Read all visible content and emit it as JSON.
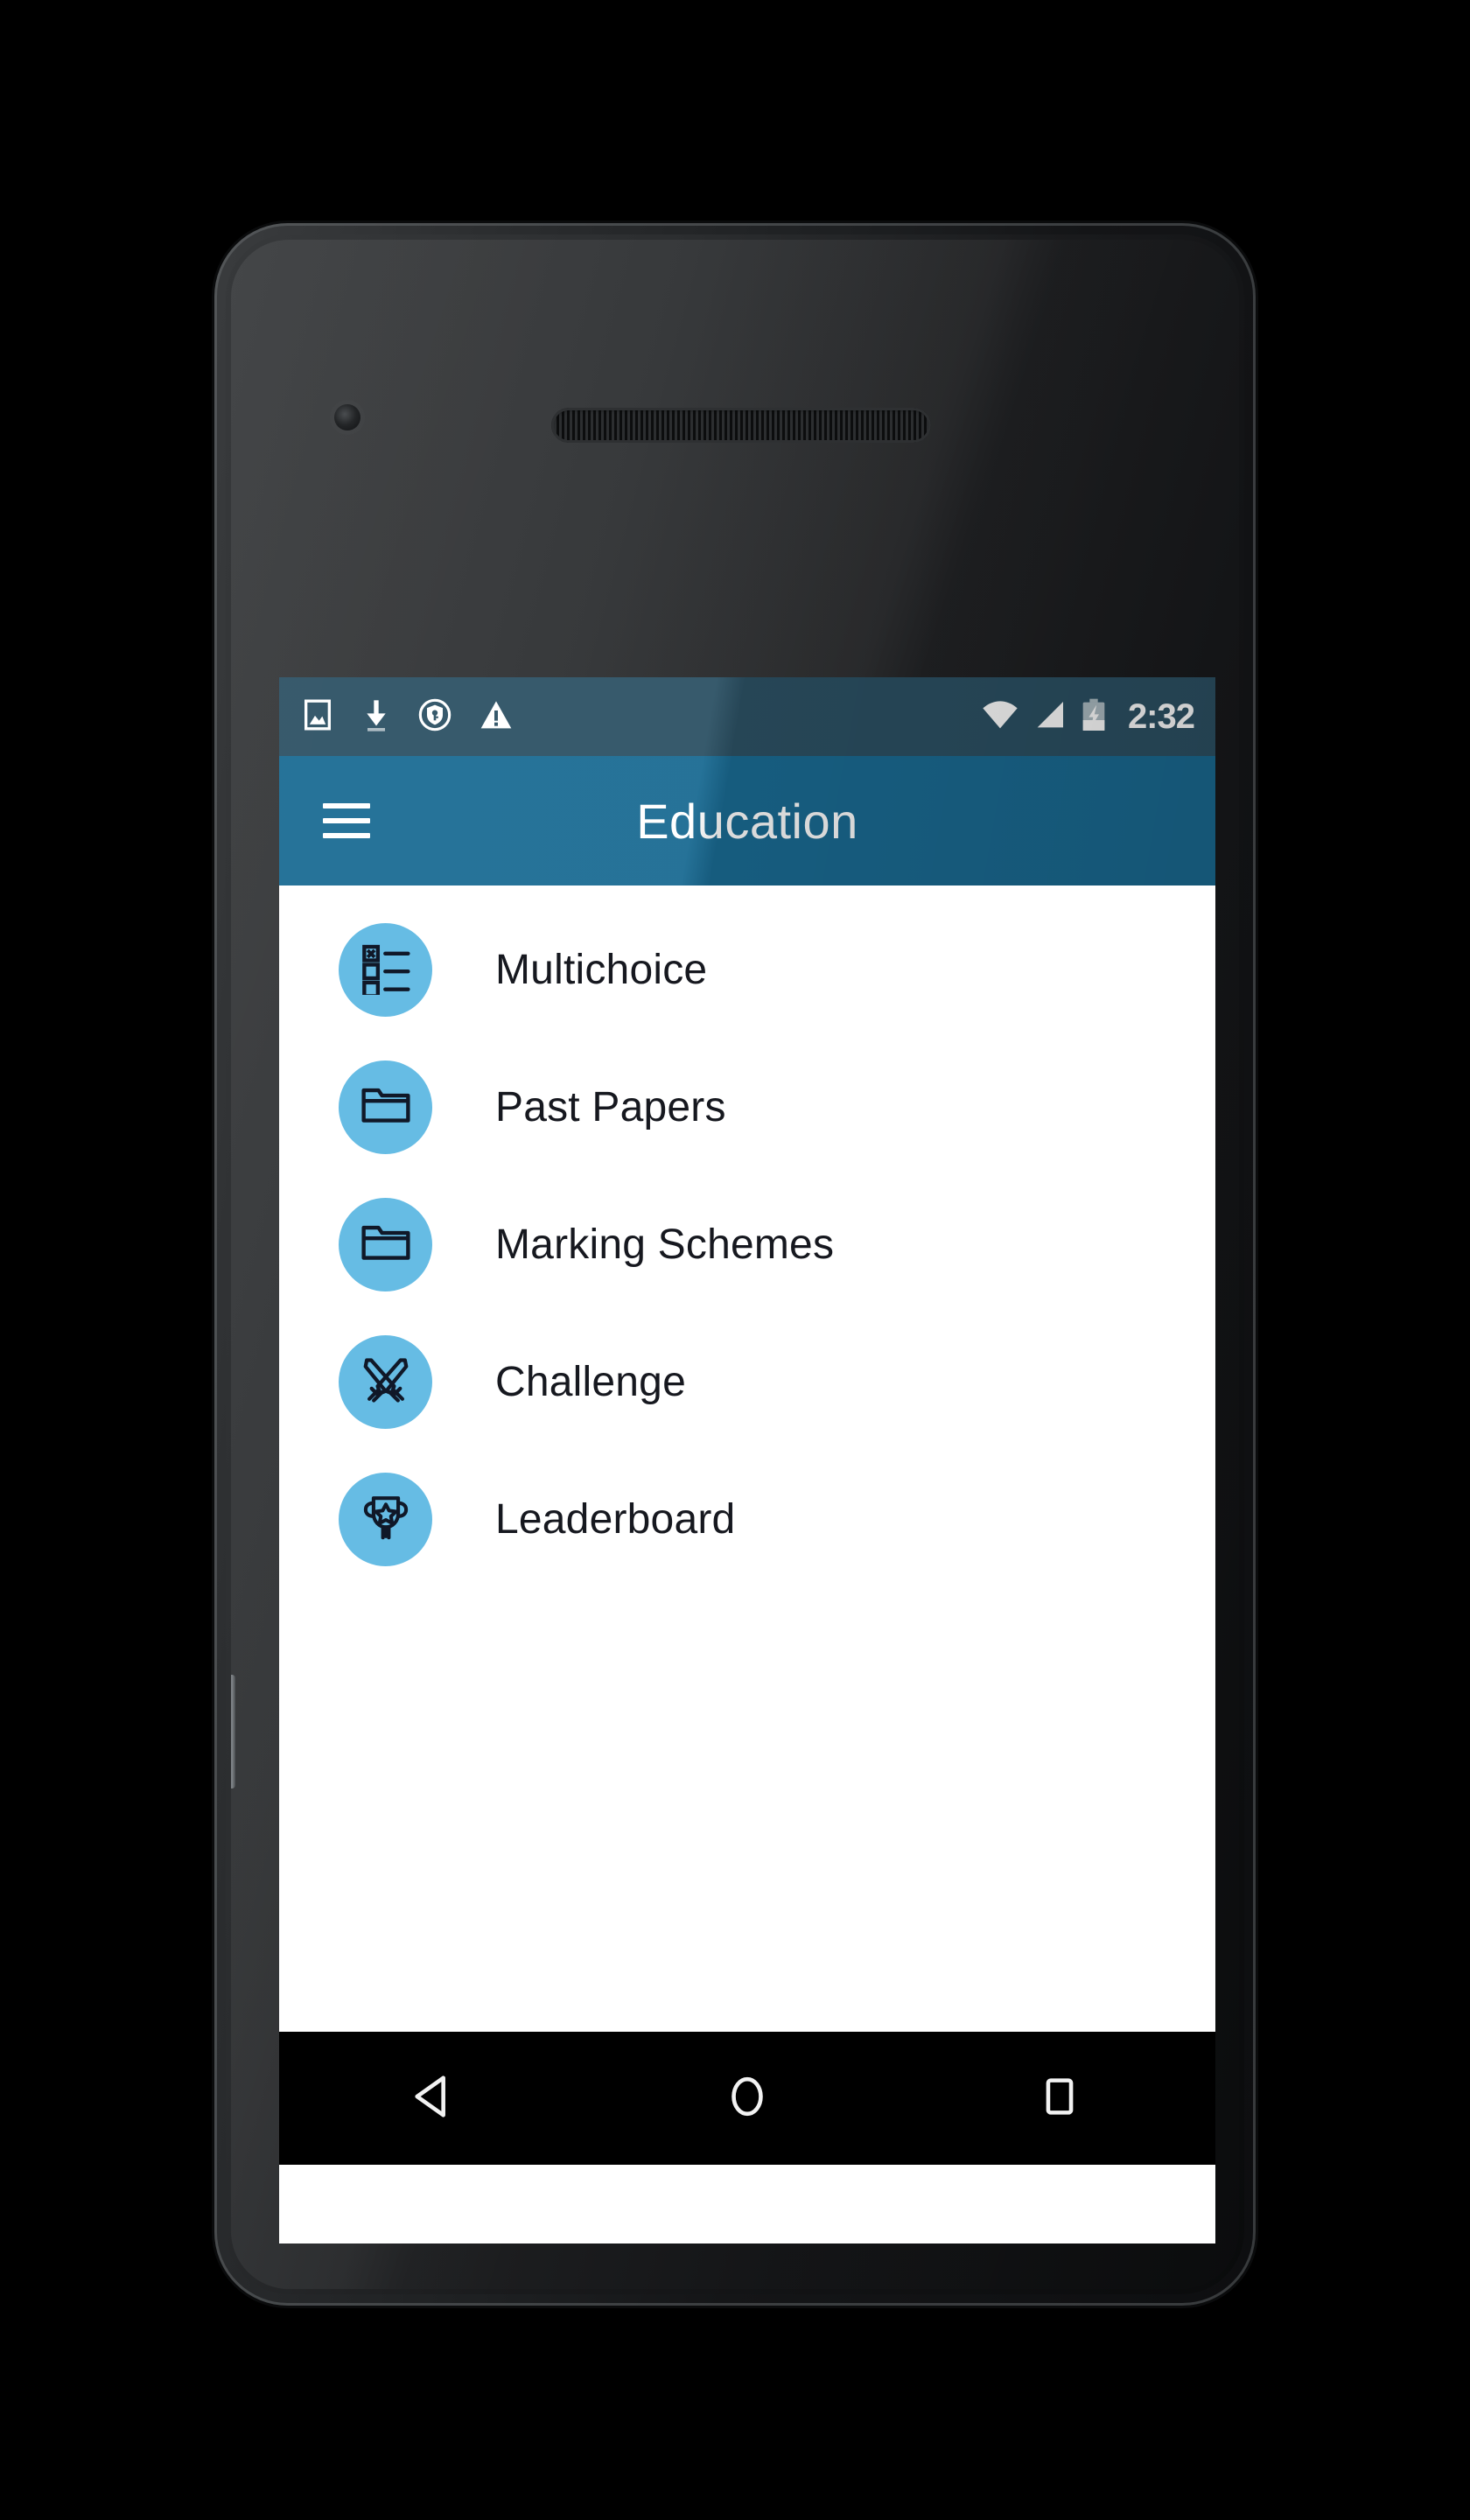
{
  "device": {
    "type": "android-phone",
    "hardware": {
      "front_camera": "front-camera",
      "earpiece": "earpiece-speaker",
      "bottom_speaker": "bottom-speaker",
      "power_button": "power-button",
      "volume_button": "volume-rocker"
    }
  },
  "status_bar": {
    "background_color": "#2c5164",
    "left_icons": [
      {
        "name": "screenshot-icon",
        "label": "Screenshot"
      },
      {
        "name": "download-icon",
        "label": "Download"
      },
      {
        "name": "vpn-shield-icon",
        "label": "VPN"
      },
      {
        "name": "warning-icon",
        "label": "Warning"
      }
    ],
    "right_icons": [
      {
        "name": "wifi-icon",
        "label": "Wi-Fi"
      },
      {
        "name": "cell-signal-icon",
        "label": "Cellular signal"
      },
      {
        "name": "battery-charging-icon",
        "label": "Battery charging"
      }
    ],
    "clock": "2:32"
  },
  "app_bar": {
    "title": "Education",
    "menu_label": "Menu",
    "background_color": "#1a6b93",
    "text_color": "#ffffff"
  },
  "theme": {
    "accent": "#1a6b93",
    "badge_background": "#66bce4",
    "icon_stroke": "#101828",
    "list_text": "#16181f",
    "screen_background": "#ffffff"
  },
  "main": {
    "items": [
      {
        "label": "Multichoice",
        "icon": "multichoice-icon"
      },
      {
        "label": "Past Papers",
        "icon": "folder-icon"
      },
      {
        "label": "Marking Schemes",
        "icon": "folder-icon"
      },
      {
        "label": "Challenge",
        "icon": "crossed-swords-icon"
      },
      {
        "label": "Leaderboard",
        "icon": "trophy-icon"
      }
    ]
  },
  "nav_bar": {
    "background_color": "#000000",
    "buttons": [
      {
        "name": "back-button",
        "label": "Back"
      },
      {
        "name": "home-button",
        "label": "Home"
      },
      {
        "name": "recent-apps-button",
        "label": "Recent apps"
      }
    ]
  }
}
